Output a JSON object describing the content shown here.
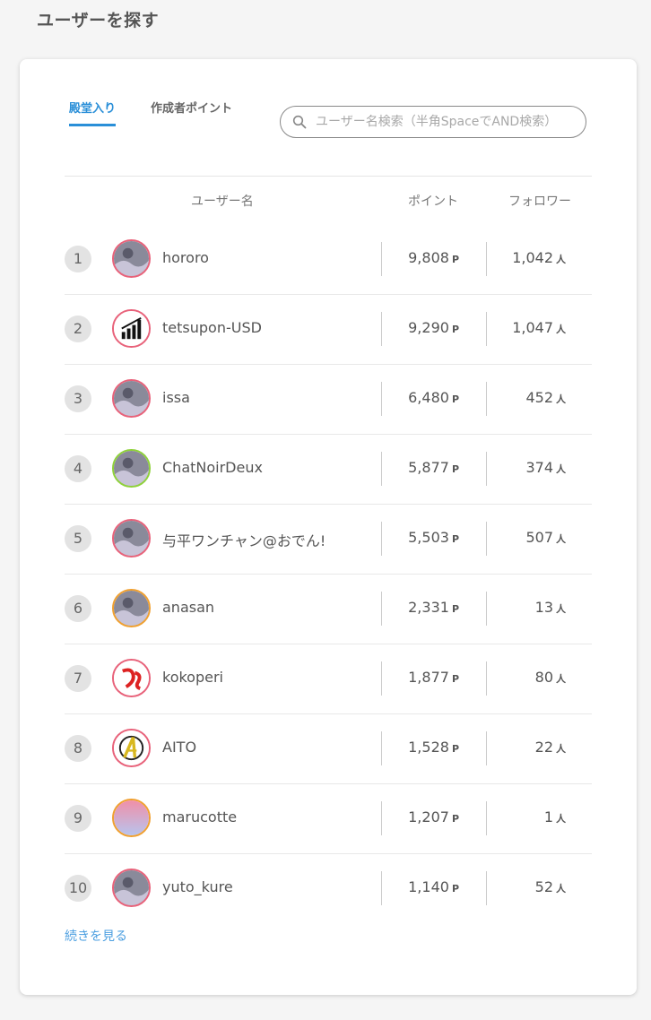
{
  "page": {
    "title": "ユーザーを探す"
  },
  "tabs": [
    {
      "label": "殿堂入り",
      "active": true
    },
    {
      "label": "作成者ポイント",
      "active": false
    }
  ],
  "search": {
    "placeholder": "ユーザー名検索（半角SpaceでAND検索）",
    "value": ""
  },
  "table": {
    "headers": {
      "user": "ユーザー名",
      "points": "ポイント",
      "followers": "フォロワー"
    },
    "points_unit": "P",
    "followers_unit": "人",
    "rows": [
      {
        "rank": "1",
        "name": "hororo",
        "points": "9,808",
        "followers": "1,042",
        "ring_color": "#e8627a",
        "avatar": "photo-icon"
      },
      {
        "rank": "2",
        "name": "tetsupon-USD",
        "points": "9,290",
        "followers": "1,047",
        "ring_color": "#e8627a",
        "avatar": "bar-chart-icon"
      },
      {
        "rank": "3",
        "name": "issa",
        "points": "6,480",
        "followers": "452",
        "ring_color": "#e8627a",
        "avatar": "photo-icon"
      },
      {
        "rank": "4",
        "name": "ChatNoirDeux",
        "points": "5,877",
        "followers": "374",
        "ring_color": "#8fd13a",
        "avatar": "photo-icon"
      },
      {
        "rank": "5",
        "name": "与平ワンチャン@おでん!",
        "points": "5,503",
        "followers": "507",
        "ring_color": "#e8627a",
        "avatar": "photo-icon"
      },
      {
        "rank": "6",
        "name": "anasan",
        "points": "2,331",
        "followers": "13",
        "ring_color": "#f0a030",
        "avatar": "photo-icon"
      },
      {
        "rank": "7",
        "name": "kokoperi",
        "points": "1,877",
        "followers": "80",
        "ring_color": "#e8627a",
        "avatar": "logo-icon"
      },
      {
        "rank": "8",
        "name": "AITO",
        "points": "1,528",
        "followers": "22",
        "ring_color": "#e8627a",
        "avatar": "avengers-logo-icon"
      },
      {
        "rank": "9",
        "name": "marucotte",
        "points": "1,207",
        "followers": "1",
        "ring_color": "#f0a030",
        "avatar": "gradient-icon"
      },
      {
        "rank": "10",
        "name": "yuto_kure",
        "points": "1,140",
        "followers": "52",
        "ring_color": "#e8627a",
        "avatar": "photo-icon"
      }
    ]
  },
  "more_link": "続きを見る",
  "colors": {
    "accent": "#2a8fd8",
    "link": "#4a9ee0",
    "ring_default": "#e8627a"
  }
}
